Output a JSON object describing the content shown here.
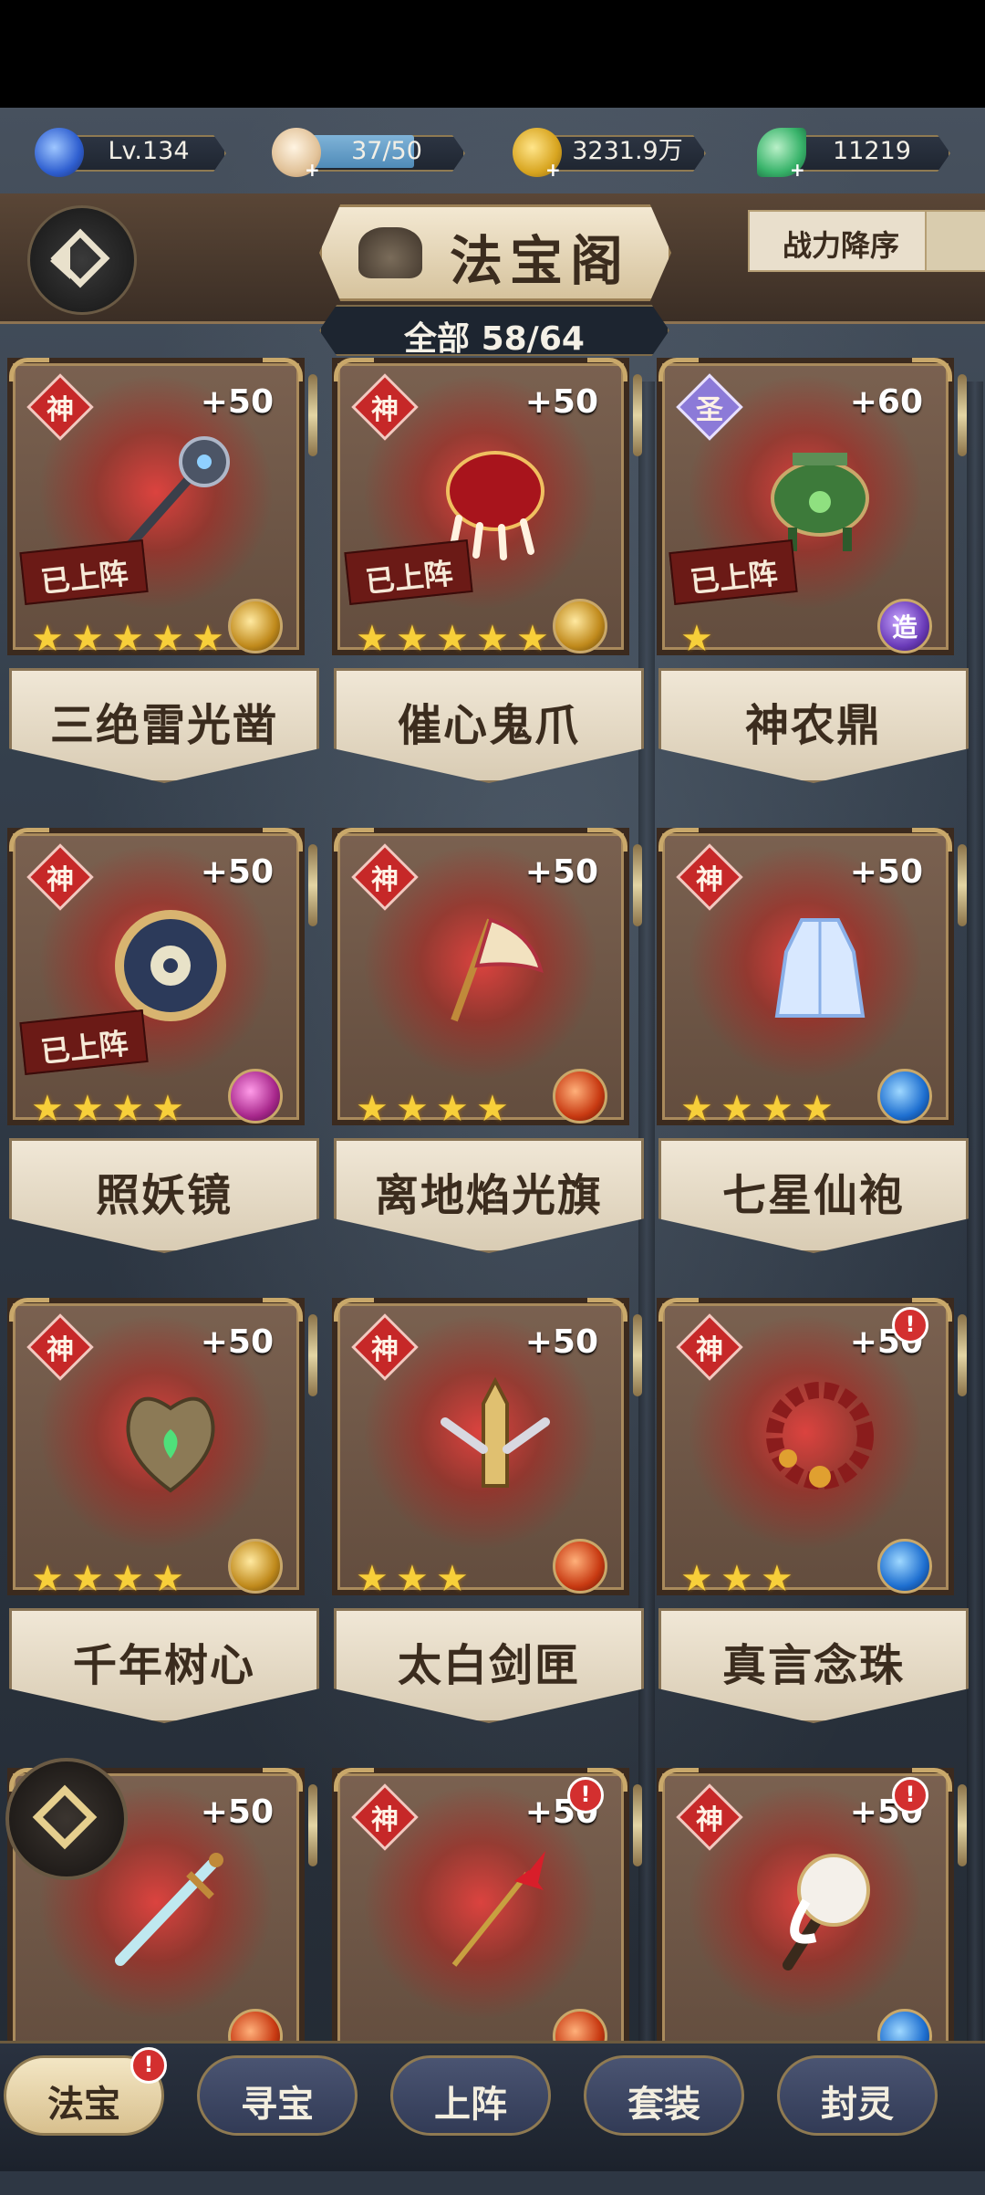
{
  "resources": [
    {
      "name": "level",
      "text": "Lv.134",
      "icon": "flame-orb-icon",
      "color": "#4a7de0"
    },
    {
      "name": "stamina",
      "text": "37/50",
      "icon": "bun-icon",
      "color": "#e9d2b2",
      "fill": 0.74
    },
    {
      "name": "coins",
      "text": "3231.9万",
      "icon": "coin-icon",
      "color": "#d8a520"
    },
    {
      "name": "jade",
      "text": "11219",
      "icon": "jade-leaf-icon",
      "color": "#38b36a"
    }
  ],
  "header": {
    "title": "法宝阁",
    "sort_label": "战力降序",
    "count_label": "全部 58/64"
  },
  "items": [
    {
      "name": "三绝雷光凿",
      "grade": "神",
      "level": "+50",
      "stars": 5,
      "deployed": "已上阵",
      "element": "gold",
      "alert": false
    },
    {
      "name": "催心鬼爪",
      "grade": "神",
      "level": "+50",
      "stars": 5,
      "deployed": "已上阵",
      "element": "gold",
      "alert": false
    },
    {
      "name": "神农鼎",
      "grade": "圣",
      "level": "+60",
      "stars": 1,
      "deployed": "已上阵",
      "element": "craft",
      "element_text": "造",
      "alert": false
    },
    {
      "name": "照妖镜",
      "grade": "神",
      "level": "+50",
      "stars": 4,
      "deployed": "已上阵",
      "element": "purple",
      "alert": false
    },
    {
      "name": "离地焰光旗",
      "grade": "神",
      "level": "+50",
      "stars": 4,
      "deployed": "",
      "element": "fire",
      "alert": false
    },
    {
      "name": "七星仙袍",
      "grade": "神",
      "level": "+50",
      "stars": 4,
      "deployed": "",
      "element": "blue",
      "alert": false
    },
    {
      "name": "千年树心",
      "grade": "神",
      "level": "+50",
      "stars": 4,
      "deployed": "",
      "element": "gold",
      "alert": false
    },
    {
      "name": "太白剑匣",
      "grade": "神",
      "level": "+50",
      "stars": 3,
      "deployed": "",
      "element": "fire",
      "alert": false
    },
    {
      "name": "真言念珠",
      "grade": "神",
      "level": "+50",
      "stars": 3,
      "deployed": "",
      "element": "blue",
      "alert": true
    },
    {
      "name": "",
      "grade": "",
      "level": "+50",
      "stars": 0,
      "deployed": "",
      "element": "fire",
      "alert": false
    },
    {
      "name": "",
      "grade": "神",
      "level": "+50",
      "stars": 0,
      "deployed": "",
      "element": "fire",
      "alert": true
    },
    {
      "name": "",
      "grade": "神",
      "level": "+50",
      "stars": 0,
      "deployed": "",
      "element": "blue",
      "alert": true
    }
  ],
  "alert_mark": "!",
  "tabs": [
    {
      "label": "法宝",
      "active": true,
      "alert": true
    },
    {
      "label": "寻宝",
      "active": false,
      "alert": false
    },
    {
      "label": "上阵",
      "active": false,
      "alert": false
    },
    {
      "label": "套装",
      "active": false,
      "alert": false
    },
    {
      "label": "封灵",
      "active": false,
      "alert": false
    }
  ]
}
